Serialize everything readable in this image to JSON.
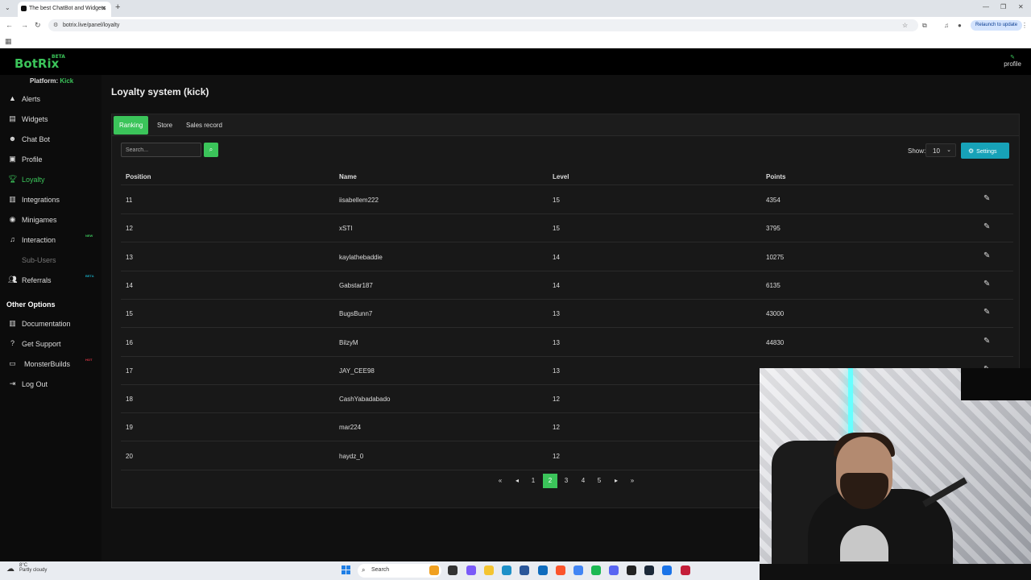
{
  "browser": {
    "tab_title": "The best ChatBot and Widgets",
    "url": "botrix.live/panel/loyalty",
    "relaunch_label": "Relaunch to update"
  },
  "app": {
    "logo": "BotRix",
    "logo_badge": "BETA",
    "profile_label": "profile"
  },
  "sidebar": {
    "platform_label": "Platform:",
    "platform_value": "Kick",
    "items": [
      {
        "label": "Alerts",
        "icon": "warning-icon"
      },
      {
        "label": "Widgets",
        "icon": "widgets-icon"
      },
      {
        "label": "Chat Bot",
        "icon": "robot-icon"
      },
      {
        "label": "Profile",
        "icon": "id-card-icon"
      },
      {
        "label": "Loyalty",
        "icon": "trophy-icon",
        "active": true
      },
      {
        "label": "Integrations",
        "icon": "integrations-icon"
      },
      {
        "label": "Minigames",
        "icon": "gamepad-icon"
      },
      {
        "label": "Interaction",
        "icon": "music-icon",
        "tag": "NEW"
      },
      {
        "label": "Sub-Users",
        "icon": "sub-users-icon",
        "disabled": true
      },
      {
        "label": "Referrals",
        "icon": "users-icon",
        "tag": "BETA"
      }
    ],
    "other_title": "Other Options",
    "other_items": [
      {
        "label": "Documentation",
        "icon": "book-icon"
      },
      {
        "label": "Get Support",
        "icon": "question-icon"
      },
      {
        "label": "MonsterBuilds",
        "icon": "laptop-icon",
        "tag": "HOT"
      },
      {
        "label": "Log Out",
        "icon": "logout-icon"
      }
    ],
    "colors": {
      "accent": "#3bc45a",
      "new_tag": "#3bc45a",
      "beta_tag": "#17a2b8",
      "hot_tag": "#dc3545"
    }
  },
  "main": {
    "title": "Loyalty system (kick)",
    "tabs": [
      {
        "label": "Ranking",
        "active": true
      },
      {
        "label": "Store"
      },
      {
        "label": "Sales record"
      }
    ],
    "search_placeholder": "Search...",
    "show_label": "Show:",
    "show_value": "10",
    "settings_label": "Settings",
    "columns": [
      "Position",
      "Name",
      "Level",
      "Points"
    ],
    "rows": [
      {
        "position": "11",
        "name": "iisabellem222",
        "level": "15",
        "points": "4354"
      },
      {
        "position": "12",
        "name": "xSTI",
        "level": "15",
        "points": "3795"
      },
      {
        "position": "13",
        "name": "kaylathebaddie",
        "level": "14",
        "points": "10275"
      },
      {
        "position": "14",
        "name": "Gabstar187",
        "level": "14",
        "points": "6135"
      },
      {
        "position": "15",
        "name": "BugsBunn7",
        "level": "13",
        "points": "43000"
      },
      {
        "position": "16",
        "name": "BilzyM",
        "level": "13",
        "points": "44830"
      },
      {
        "position": "17",
        "name": "JAY_CEE98",
        "level": "13",
        "points": ""
      },
      {
        "position": "18",
        "name": "CashYabadabado",
        "level": "12",
        "points": ""
      },
      {
        "position": "19",
        "name": "mar224",
        "level": "12",
        "points": ""
      },
      {
        "position": "20",
        "name": "haydz_0",
        "level": "12",
        "points": ""
      }
    ],
    "pagination": {
      "pages": [
        "1",
        "2",
        "3",
        "4",
        "5"
      ],
      "current": "2"
    }
  },
  "taskbar": {
    "temp": "8°C",
    "weather": "Partly cloudy",
    "search_label": "Search"
  }
}
